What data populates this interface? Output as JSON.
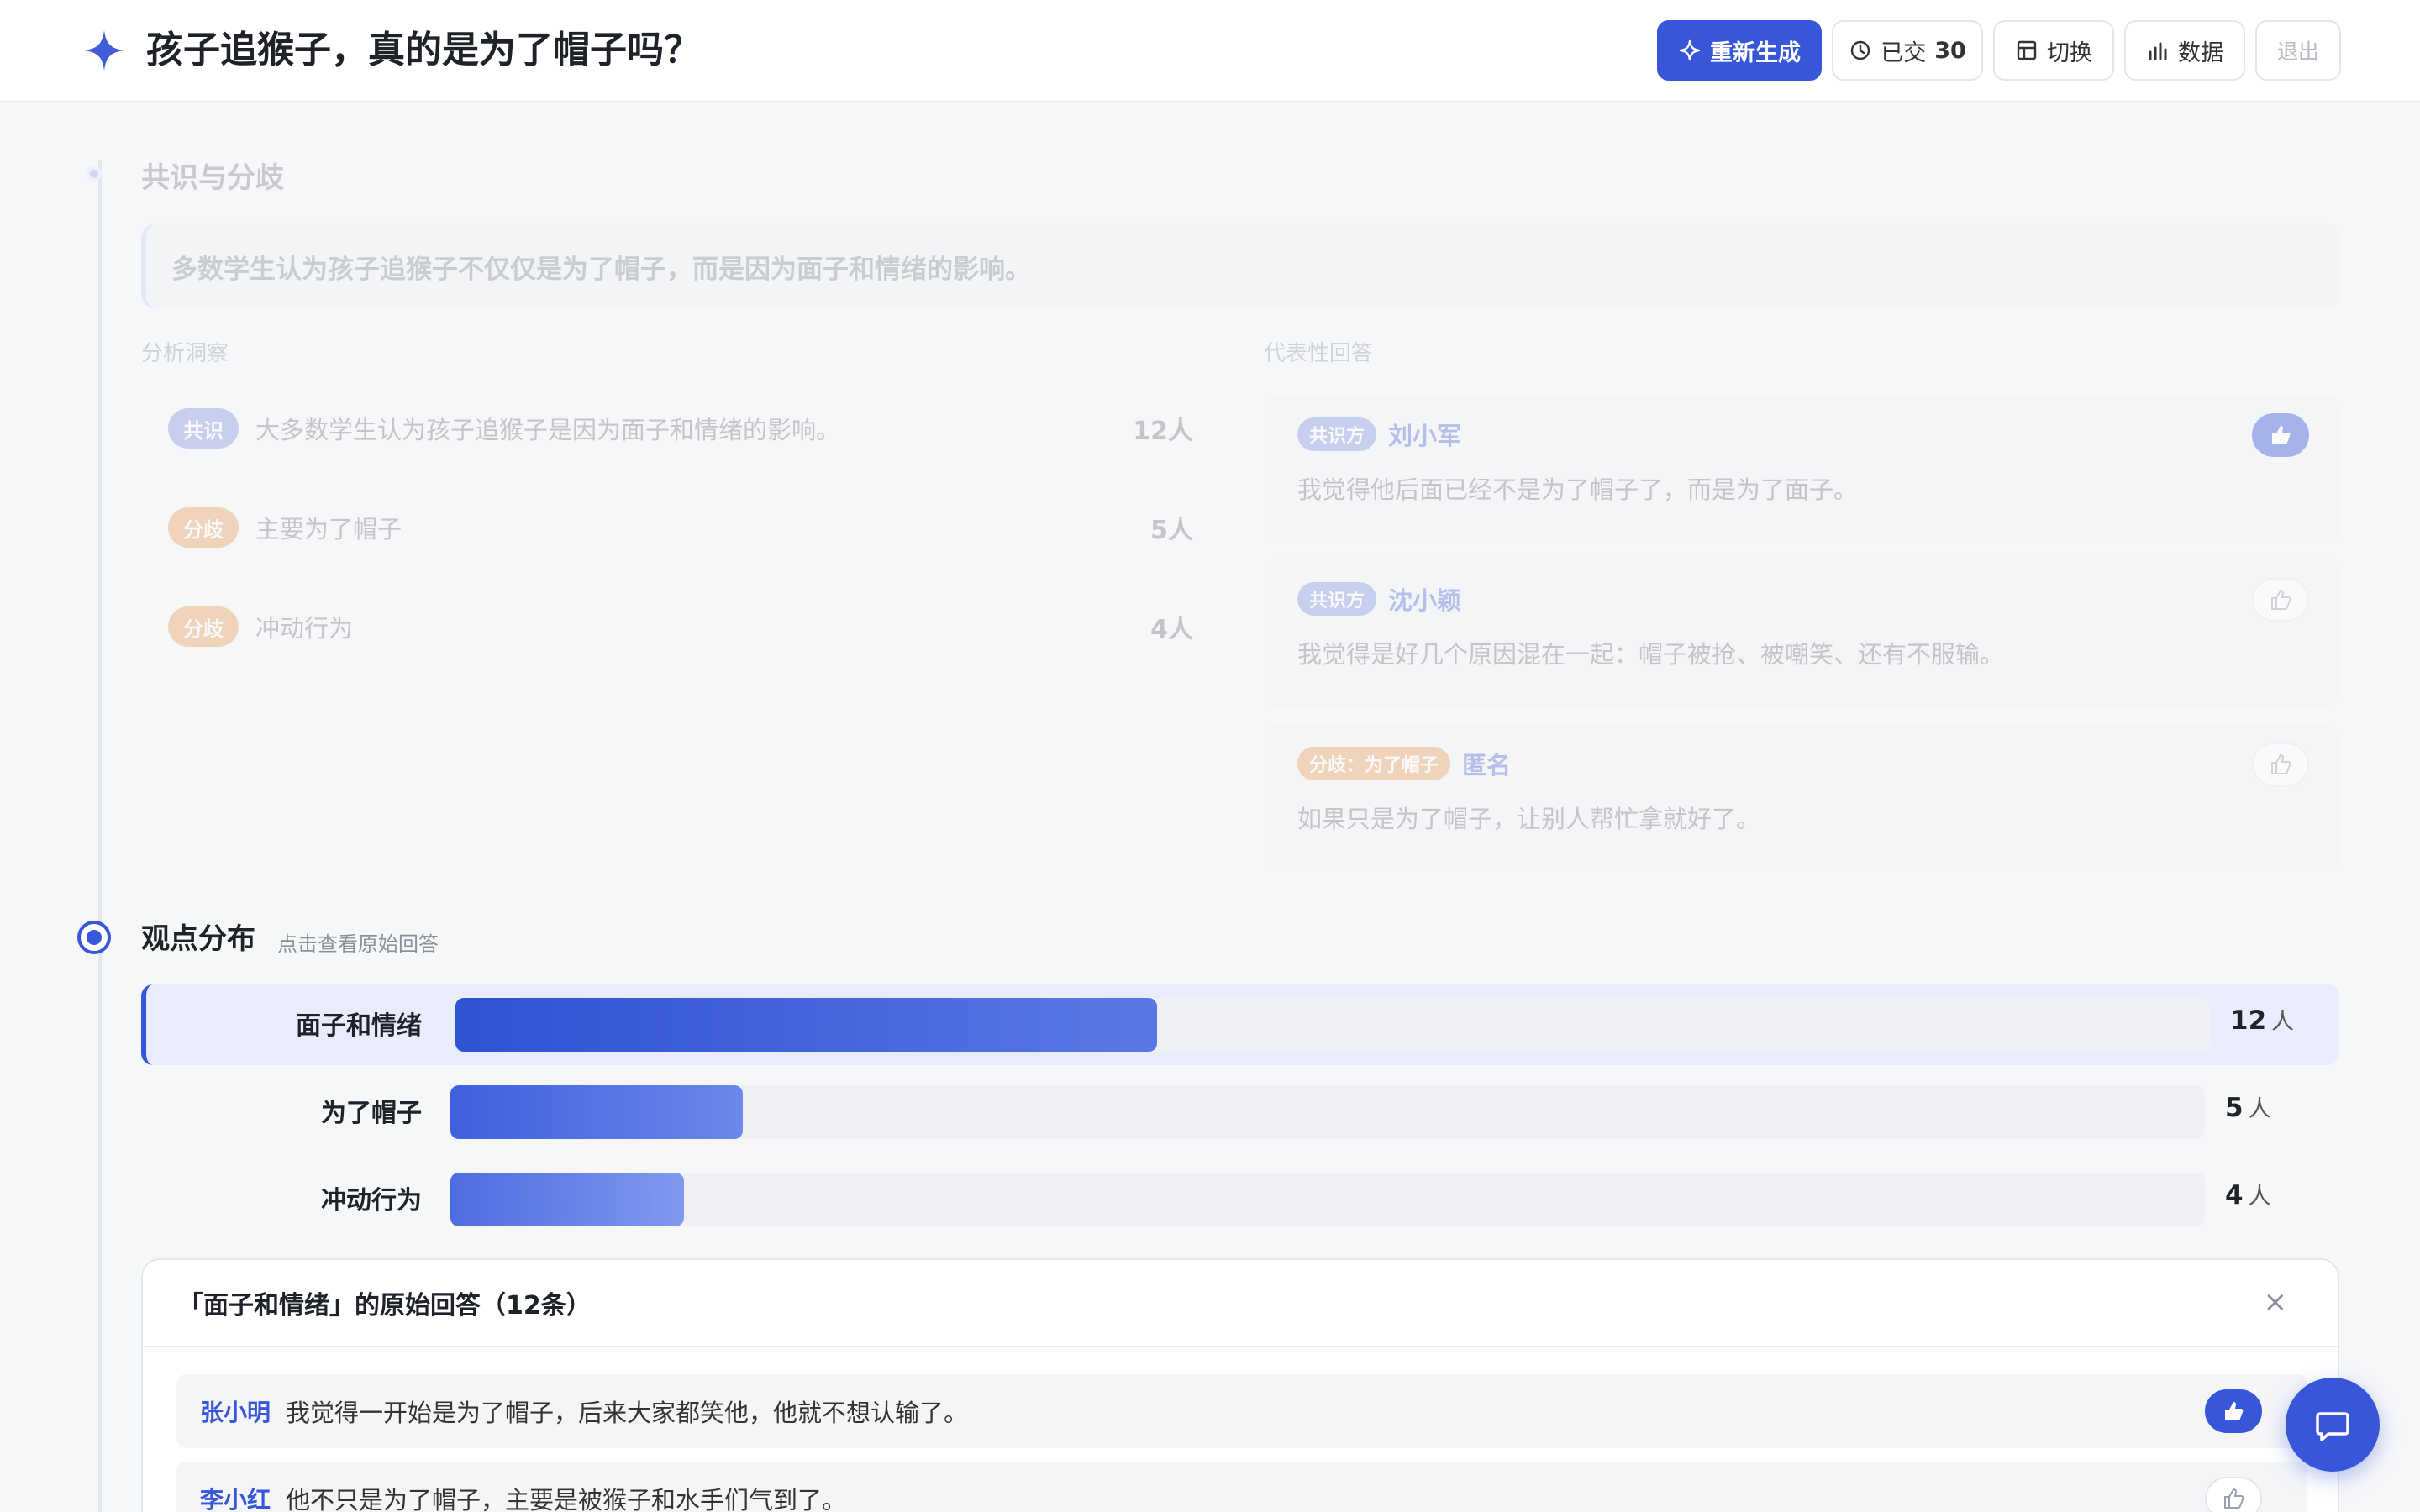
{
  "header": {
    "title": "孩子追猴子，真的是为了帽子吗？",
    "regenerate_label": "重新生成",
    "submitted_prefix": "已交",
    "submitted_count": "30",
    "switch_label": "切换",
    "data_label": "数据",
    "exit_label": "退出"
  },
  "consensus": {
    "title": "共识与分歧",
    "summary": "多数学生认为孩子追猴子不仅仅是为了帽子，而是因为面子和情绪的影响。",
    "insights_heading": "分析洞察",
    "representative_heading": "代表性回答",
    "insights": [
      {
        "tag": "共识",
        "kind": "consensus",
        "text": "大多数学生认为孩子追猴子是因为面子和情绪的影响。",
        "count": "12人"
      },
      {
        "tag": "分歧",
        "kind": "divergence",
        "text": "主要为了帽子",
        "count": "5人"
      },
      {
        "tag": "分歧",
        "kind": "divergence",
        "text": "冲动行为",
        "count": "4人"
      }
    ],
    "representative": [
      {
        "tag": "共识方",
        "kind": "consensus",
        "name": "刘小军",
        "text": "我觉得他后面已经不是为了帽子了，而是为了面子。",
        "liked": true
      },
      {
        "tag": "共识方",
        "kind": "consensus",
        "name": "沈小颖",
        "text": "我觉得是好几个原因混在一起：帽子被抢、被嘲笑、还有不服输。",
        "liked": false
      },
      {
        "tag": "分歧：为了帽子",
        "kind": "divergence",
        "name": "匿名",
        "text": "如果只是为了帽子，让别人帮忙拿就好了。",
        "liked": false
      }
    ]
  },
  "distribution": {
    "title": "观点分布",
    "hint": "点击查看原始回答",
    "unit": "人",
    "items": [
      {
        "label": "面子和情绪",
        "count": 12,
        "selected": true
      },
      {
        "label": "为了帽子",
        "count": 5,
        "selected": false
      },
      {
        "label": "冲动行为",
        "count": 4,
        "selected": false
      }
    ],
    "max": 30
  },
  "answers_panel": {
    "title": "「面子和情绪」的原始回答（12条）",
    "close": "×",
    "answers": [
      {
        "name": "张小明",
        "text": "我觉得一开始是为了帽子，后来大家都笑他，他就不想认输了。",
        "liked": true
      },
      {
        "name": "李小红",
        "text": "他不只是为了帽子，主要是被猴子和水手们气到了。",
        "liked": false
      }
    ]
  },
  "colors": {
    "accent": "#3756d9",
    "consensus": "#8596e0",
    "divergence": "#e6a368"
  }
}
